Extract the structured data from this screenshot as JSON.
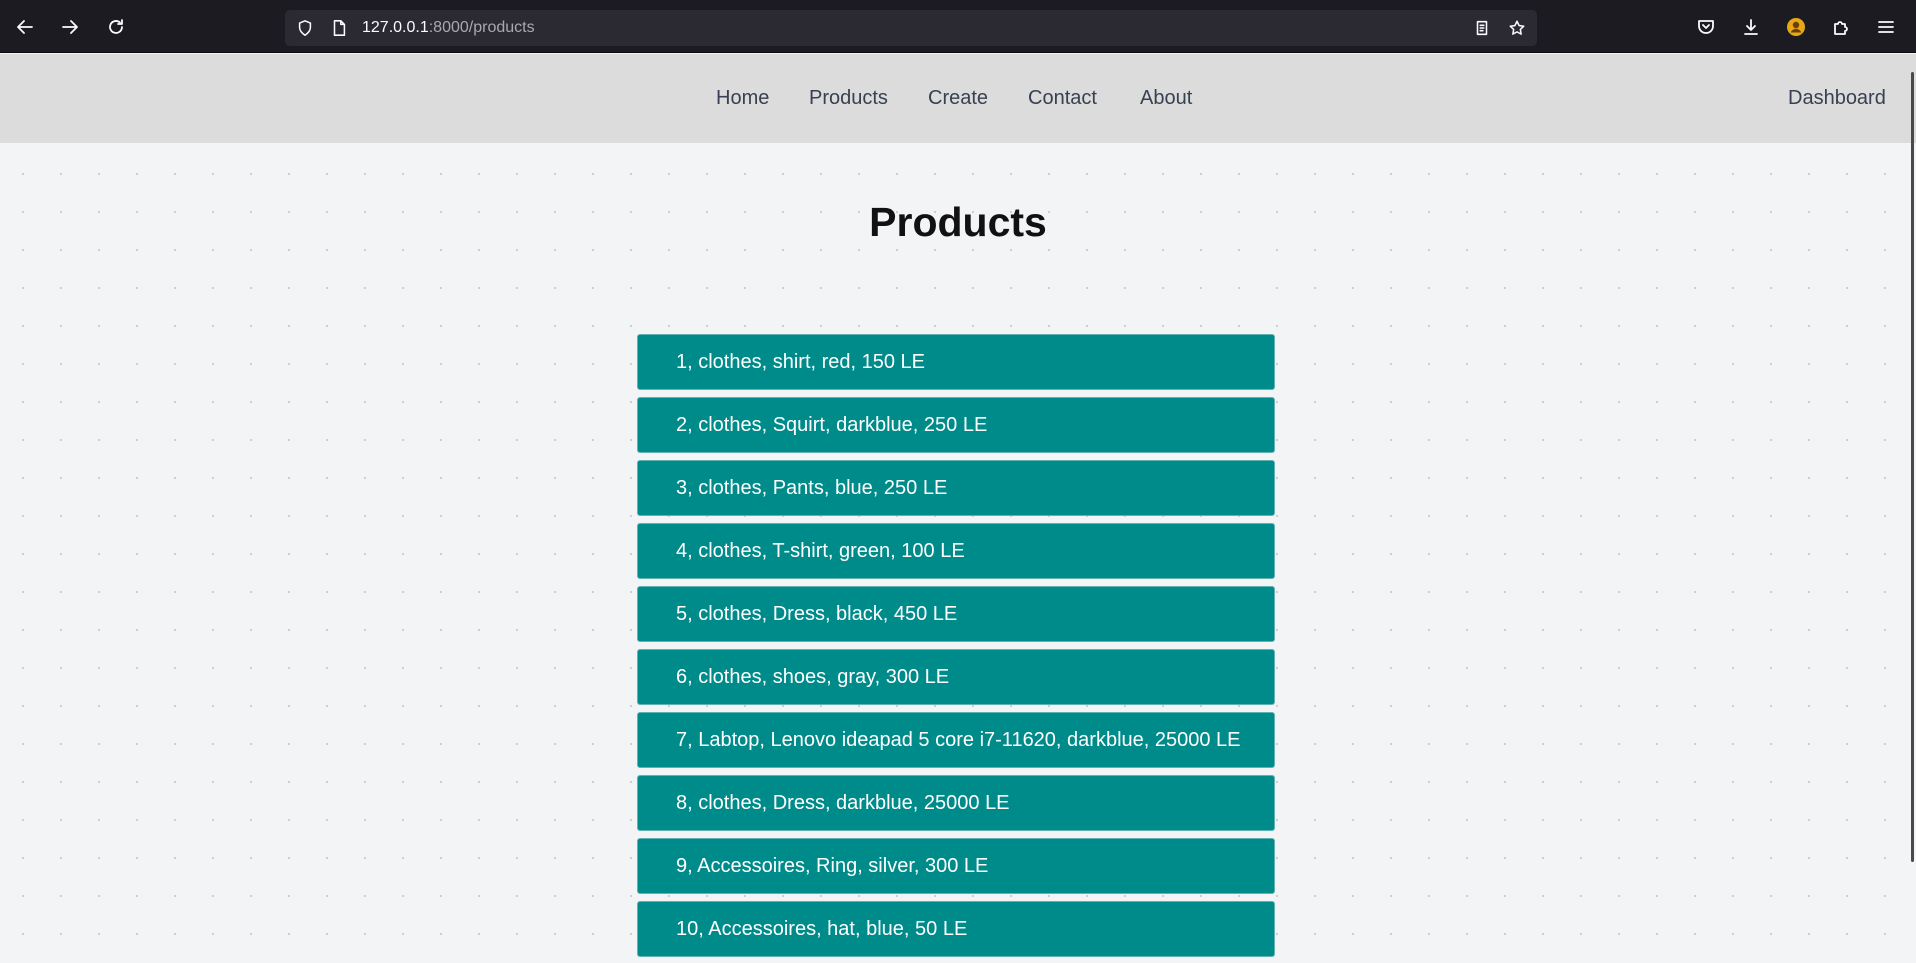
{
  "browser": {
    "url_host": "127.0.0.1",
    "url_rest": ":8000/products",
    "icons": {
      "back": "arrow-left-icon",
      "forward": "arrow-right-icon",
      "reload": "reload-icon",
      "shield": "shield-icon",
      "page": "page-icon",
      "reader": "reader-view-icon",
      "bookmark": "star-icon",
      "pocket": "pocket-icon",
      "downloads": "download-icon",
      "profile": "profile-icon",
      "extensions": "puzzle-icon",
      "menu": "hamburger-menu-icon"
    }
  },
  "nav": {
    "links": [
      "Home",
      "Products",
      "Create",
      "Contact",
      "About"
    ],
    "dashboard": "Dashboard"
  },
  "main": {
    "title": "Products",
    "products": [
      "1, clothes, shirt, red, 150 LE",
      "2, clothes, Squirt, darkblue, 250 LE",
      "3, clothes, Pants, blue, 250 LE",
      "4, clothes, T-shirt, green, 100 LE",
      "5, clothes, Dress, black, 450 LE",
      "6, clothes, shoes, gray, 300 LE",
      "7, Labtop, Lenovo ideapad 5 core i7-11620, darkblue, 25000 LE",
      "8, clothes, Dress, darkblue, 25000 LE",
      "9, Accessoires, Ring, silver, 300 LE",
      "10, Accessoires, hat, blue, 50 LE"
    ]
  },
  "colors": {
    "browser_chrome": "#1c1b22",
    "navbar": "#dcdcdc",
    "page_bg": "#f3f4f6",
    "product_item": "#008b8b"
  }
}
